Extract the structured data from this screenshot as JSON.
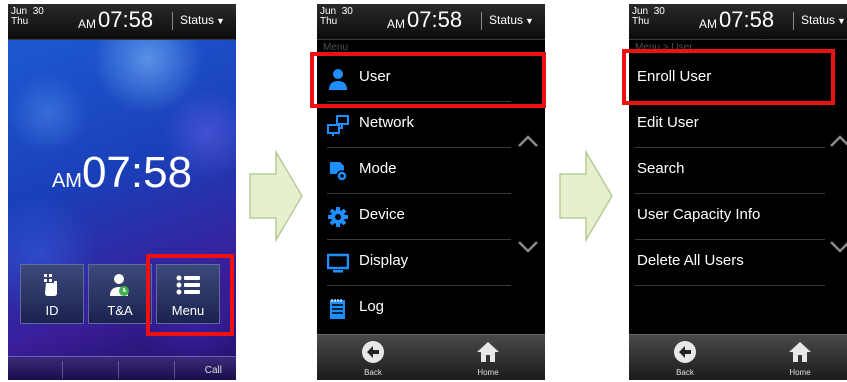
{
  "statusbar": {
    "month": "Jun",
    "date": "30",
    "day": "Thu",
    "ampm": "AM",
    "time": "07:58",
    "status_label": "Status"
  },
  "home": {
    "clock_ampm": "AM",
    "clock_time": "07:58",
    "buttons": [
      {
        "label": "ID",
        "icon": "hand-finger-icon"
      },
      {
        "label": "T&A",
        "icon": "user-clock-icon"
      },
      {
        "label": "Menu",
        "icon": "list-icon"
      }
    ],
    "call_label": "Call"
  },
  "menu": {
    "breadcrumb": "Menu",
    "items": [
      {
        "label": "User",
        "icon": "user-icon"
      },
      {
        "label": "Network",
        "icon": "network-icon"
      },
      {
        "label": "Mode",
        "icon": "mode-icon"
      },
      {
        "label": "Device",
        "icon": "gear-icon"
      },
      {
        "label": "Display",
        "icon": "monitor-icon"
      },
      {
        "label": "Log",
        "icon": "notepad-icon"
      }
    ]
  },
  "user_menu": {
    "breadcrumb": "Menu  >  User",
    "items": [
      {
        "label": "Enroll User"
      },
      {
        "label": "Edit User"
      },
      {
        "label": "Search"
      },
      {
        "label": "User Capacity Info"
      },
      {
        "label": "Delete All Users"
      }
    ]
  },
  "navbar": {
    "back_label": "Back",
    "home_label": "Home"
  },
  "colors": {
    "highlight": "#ee1111",
    "accent_blue": "#1e8fff",
    "arrow_fill": "#e6f0cf"
  }
}
